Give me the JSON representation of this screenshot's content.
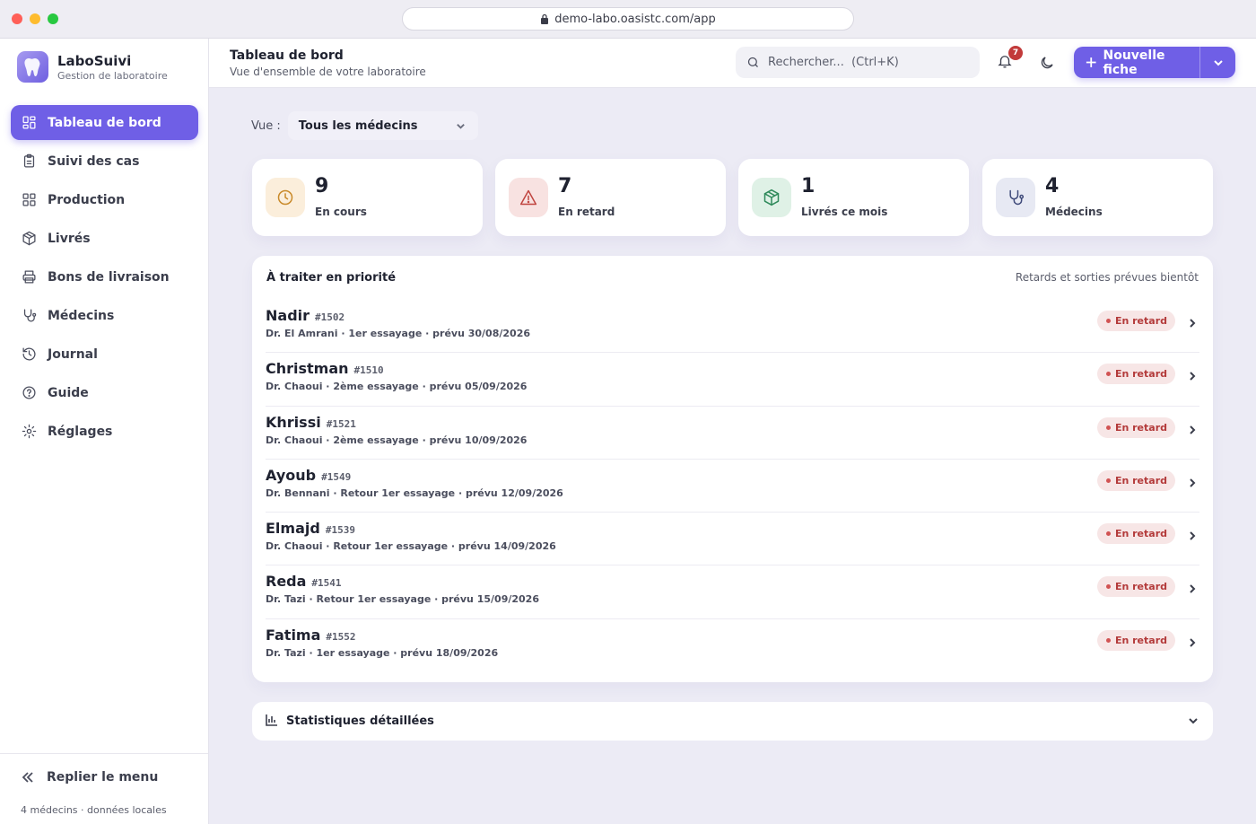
{
  "browser": {
    "url": "demo-labo.oasistc.com/app"
  },
  "brand": {
    "name": "LaboSuivi",
    "subtitle": "Gestion de laboratoire"
  },
  "sidebar": {
    "items": [
      {
        "label": "Tableau de bord",
        "icon": "dashboard-icon",
        "active": true
      },
      {
        "label": "Suivi des cas",
        "icon": "clipboard-icon"
      },
      {
        "label": "Production",
        "icon": "grid-icon"
      },
      {
        "label": "Livrés",
        "icon": "package-icon"
      },
      {
        "label": "Bons de livraison",
        "icon": "printer-icon"
      },
      {
        "label": "Médecins",
        "icon": "stethoscope-icon"
      },
      {
        "label": "Journal",
        "icon": "history-icon"
      },
      {
        "label": "Guide",
        "icon": "help-icon"
      },
      {
        "label": "Réglages",
        "icon": "gear-icon"
      }
    ],
    "collapse_label": "Replier le menu",
    "footer": "4 médecins · données locales"
  },
  "topbar": {
    "title": "Tableau de bord",
    "subtitle": "Vue d'ensemble de votre laboratoire",
    "search_placeholder": "Rechercher...  (Ctrl+K)",
    "notifications": "7",
    "new_label": "Nouvelle fiche"
  },
  "view": {
    "label": "Vue :",
    "selected": "Tous les médecins"
  },
  "stats": [
    {
      "value": "9",
      "label": "En cours",
      "icon": "clock-icon",
      "color": "#c98a2a",
      "bg": "#fbeedb"
    },
    {
      "value": "7",
      "label": "En retard",
      "icon": "warning-icon",
      "color": "#c0443f",
      "bg": "#f8e2e1"
    },
    {
      "value": "1",
      "label": "Livrés ce mois",
      "icon": "package-icon",
      "color": "#2f8a5b",
      "bg": "#dff1e6"
    },
    {
      "value": "4",
      "label": "Médecins",
      "icon": "stethoscope-icon",
      "color": "#3f4a7a",
      "bg": "#e7e9f3"
    }
  ],
  "priority": {
    "title": "À traiter en priorité",
    "hint": "Retards et sorties prévues bientôt",
    "rows": [
      {
        "name": "Nadir",
        "id": "#1502",
        "detail": "Dr. El Amrani · 1er essayage · prévu 30/08/2026",
        "status": "En retard"
      },
      {
        "name": "Christman",
        "id": "#1510",
        "detail": "Dr. Chaoui · 2ème essayage · prévu 05/09/2026",
        "status": "En retard"
      },
      {
        "name": "Khrissi",
        "id": "#1521",
        "detail": "Dr. Chaoui · 2ème essayage · prévu 10/09/2026",
        "status": "En retard"
      },
      {
        "name": "Ayoub",
        "id": "#1549",
        "detail": "Dr. Bennani · Retour 1er essayage · prévu 12/09/2026",
        "status": "En retard"
      },
      {
        "name": "Elmajd",
        "id": "#1539",
        "detail": "Dr. Chaoui · Retour 1er essayage · prévu 14/09/2026",
        "status": "En retard"
      },
      {
        "name": "Reda",
        "id": "#1541",
        "detail": "Dr. Tazi · Retour 1er essayage · prévu 15/09/2026",
        "status": "En retard"
      },
      {
        "name": "Fatima",
        "id": "#1552",
        "detail": "Dr. Tazi · 1er essayage · prévu 18/09/2026",
        "status": "En retard"
      }
    ]
  },
  "details": {
    "label": "Statistiques détaillées"
  }
}
